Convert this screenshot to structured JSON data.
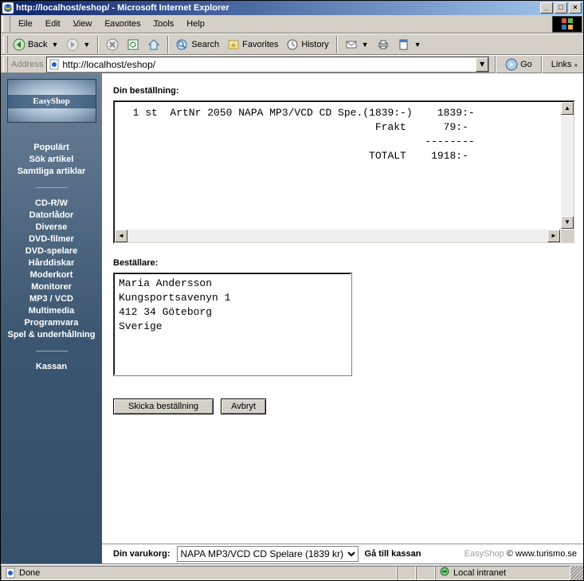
{
  "window": {
    "title": "http://localhost/eshop/ - Microsoft Internet Explorer",
    "btn_min": "_",
    "btn_max": "□",
    "btn_close": "×"
  },
  "menubar": {
    "file": "File",
    "edit": "Edit",
    "view": "View",
    "favorites": "Favorites",
    "tools": "Tools",
    "help": "Help"
  },
  "toolbar": {
    "back": "Back",
    "search": "Search",
    "favorites": "Favorites",
    "history": "History"
  },
  "addressbar": {
    "label": "Address",
    "url": "http://localhost/eshop/",
    "go": "Go",
    "links": "Links"
  },
  "sidebar": {
    "logo_text": "EasyShop",
    "group1": [
      "Populärt",
      "Sök artikel",
      "Samtliga artiklar"
    ],
    "group2": [
      "CD-R/W",
      "Datorlådor",
      "Diverse",
      "DVD-filmer",
      "DVD-spelare",
      "Hårddiskar",
      "Moderkort",
      "Monitorer",
      "MP3 / VCD",
      "Multimedia",
      "Programvara",
      "Spel & underhållning"
    ],
    "group3": [
      "Kassan"
    ]
  },
  "main": {
    "order_label": "Din beställning:",
    "customer_label": "Beställare:",
    "order_text": "  1 st  ArtNr 2050 NAPA MP3/VCD CD Spe.(1839:-)    1839:-\n                                         Frakt      79:-\n                                                 --------\n                                        TOTALT    1918:-\n",
    "customer_text": "Maria Andersson\nKungsportsavenyn 1\n412 34 Göteborg\nSverige",
    "send_btn": "Skicka beställning",
    "cancel_btn": "Avbryt"
  },
  "footer": {
    "cart_label": "Din varukorg:",
    "cart_selected": "NAPA MP3/VCD CD Spelare (1839 kr)",
    "checkout": "Gå till kassan",
    "brand": "EasyShop",
    "copyright": " © www.turismo.se"
  },
  "status": {
    "text": "Done",
    "zone": "Local intranet"
  },
  "colors": {
    "titlebar_from": "#0a246a",
    "titlebar_to": "#a6caf0",
    "chrome": "#d4d0c8",
    "sidebar_top": "#6a8097",
    "sidebar_bottom": "#34506a"
  }
}
